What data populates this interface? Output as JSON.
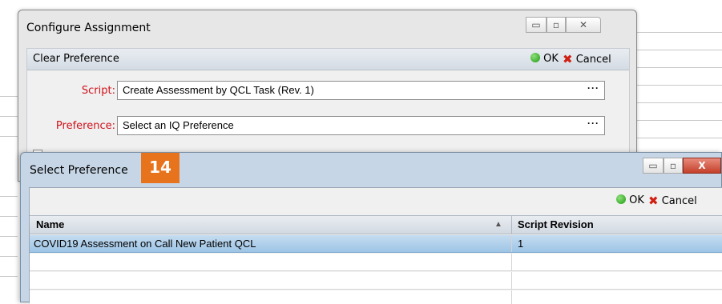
{
  "config_window": {
    "title": "Configure Assignment",
    "controls": {
      "minimize": "▭",
      "maximize": "▫",
      "close": "✕"
    },
    "panel_title": "Clear Preference",
    "ok_label": "OK",
    "cancel_label": "Cancel",
    "script_label": "Script:",
    "script_value": "Create Assessment by QCL Task (Rev. 1)",
    "preference_label": "Preference:",
    "preference_value": "Select an IQ Preference",
    "browse_label": "···"
  },
  "select_window": {
    "title": "Select Preference",
    "step_badge": "14",
    "controls": {
      "minimize": "▭",
      "maximize": "▫",
      "close": "X"
    },
    "ok_label": "OK",
    "cancel_label": "Cancel",
    "columns": [
      "Name",
      "Script Revision"
    ],
    "sort_indicator": "▲",
    "rows": [
      {
        "name": "COVID19 Assessment on Call New Patient QCL",
        "revision": "1",
        "selected": true
      },
      {
        "name": "",
        "revision": "",
        "selected": false
      },
      {
        "name": "",
        "revision": "",
        "selected": false
      }
    ]
  },
  "colors": {
    "accent_badge": "#e8731d",
    "required_label": "#d0121b",
    "selected_row": "#9ec5e6",
    "ok_icon": "#1c9a12",
    "cancel_icon": "#d01f12"
  }
}
